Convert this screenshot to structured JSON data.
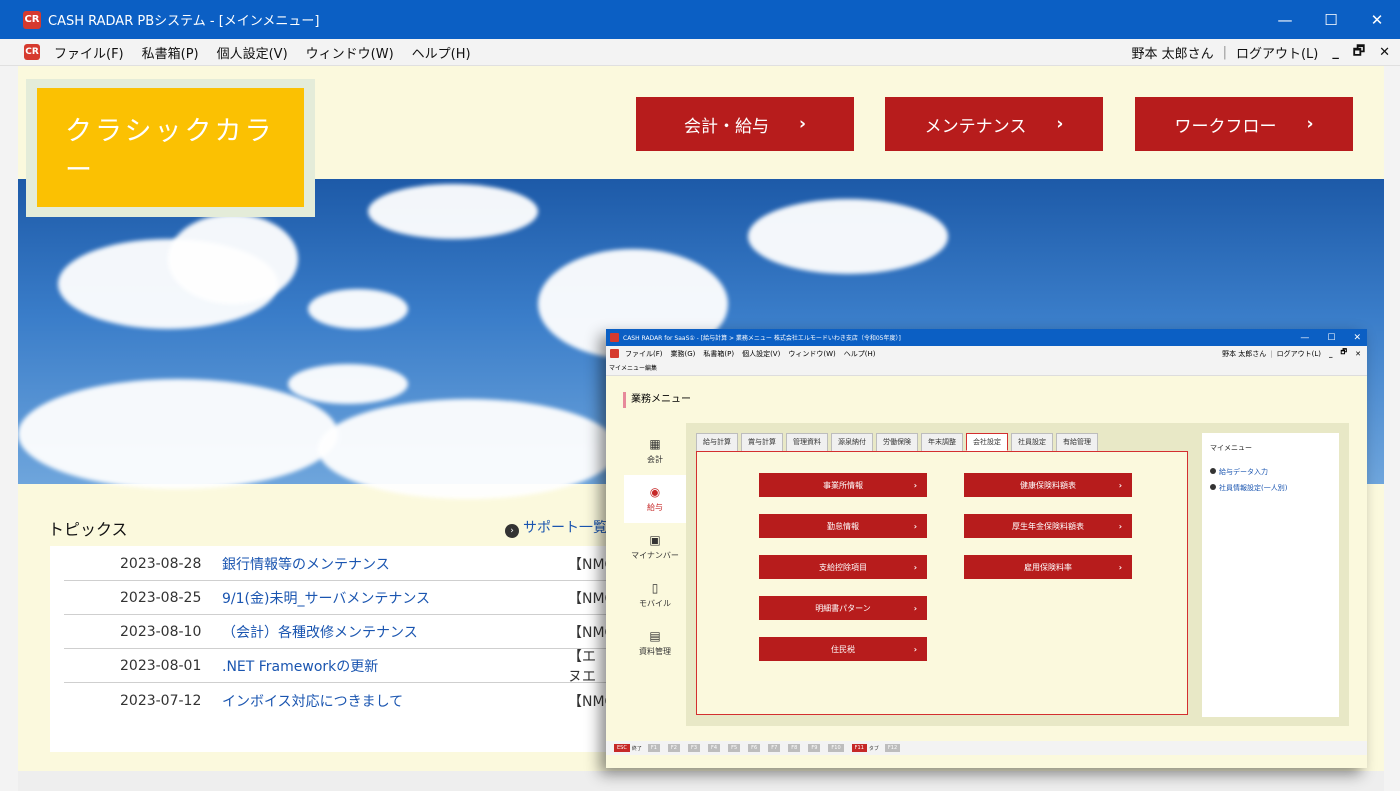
{
  "window": {
    "title": "CASH RADAR PBシステム - [メインメニュー]",
    "logo_text": "CR",
    "minimize": "—",
    "maximize": "☐",
    "close": "✕"
  },
  "menubar": {
    "items": [
      "ファイル(F)",
      "私書箱(P)",
      "個人設定(V)",
      "ウィンドウ(W)",
      "ヘルプ(H)"
    ],
    "user": "野本 太郎さん",
    "separator": "|",
    "logout": "ログアウト(L)",
    "controls": [
      "_",
      "🗗",
      "✕"
    ]
  },
  "badge": {
    "label": "クラシックカラー",
    "color": "#fbc102"
  },
  "nav_buttons": [
    {
      "label": "会計・給与",
      "arrow": "›"
    },
    {
      "label": "メンテナンス",
      "arrow": "›"
    },
    {
      "label": "ワークフロー",
      "arrow": "›"
    }
  ],
  "topics": {
    "heading": "トピックス",
    "support_link": "サポート一覧",
    "support_icon": "›",
    "items": [
      {
        "date": "2023-08-28",
        "title": "銀行情報等のメンテナンス",
        "source": "【NMC"
      },
      {
        "date": "2023-08-25",
        "title": "9/1(金)未明_サーバメンテナンス",
        "source": "【NMC"
      },
      {
        "date": "2023-08-10",
        "title": "（会計）各種改修メンテナンス",
        "source": "【NMC"
      },
      {
        "date": "2023-08-01",
        "title": ".NET Frameworkの更新",
        "source": "【エヌエ"
      },
      {
        "date": "2023-07-12",
        "title": "インボイス対応につきまして",
        "source": "【NMC"
      }
    ]
  },
  "inset": {
    "title": "CASH RADAR for SaaS① - [給与計算 > 業務メニュー 株式会社エルモードいわき支店（令和05年度）]",
    "menu": [
      "ファイル(F)",
      "業務(G)",
      "私書箱(P)",
      "個人設定(V)",
      "ウィンドウ(W)",
      "ヘルプ(H)"
    ],
    "user": "野本 太郎さん",
    "logout": "ログアウト(L)",
    "edit_label": "マイメニュー編集",
    "heading": "業務メニュー",
    "side": [
      {
        "icon": "▦",
        "label": "会計"
      },
      {
        "icon": "◉",
        "label": "給与"
      },
      {
        "icon": "▣",
        "label": "マイナンバー"
      },
      {
        "icon": "▯",
        "label": "モバイル"
      },
      {
        "icon": "▤",
        "label": "資料管理"
      }
    ],
    "tabs": [
      "給与計算",
      "賞与計算",
      "管理資料",
      "源泉納付",
      "労働保険",
      "年末調整",
      "会社設定",
      "社員設定",
      "有給管理"
    ],
    "left_buttons": [
      "事業所情報",
      "勤怠情報",
      "支給控除項目",
      "明細書パターン",
      "住民税"
    ],
    "right_buttons": [
      "健康保険料額表",
      "厚生年金保険料額表",
      "雇用保険料率"
    ],
    "button_arrow": "›",
    "mymenu_title": "マイメニュー",
    "mymenu_links": [
      "給与データ入力",
      "社員情報設定(一人別)"
    ],
    "fkeys": [
      {
        "key": "ESC",
        "label": "終了",
        "active": true
      },
      {
        "key": "F1",
        "label": ""
      },
      {
        "key": "F2",
        "label": ""
      },
      {
        "key": "F3",
        "label": ""
      },
      {
        "key": "F4",
        "label": ""
      },
      {
        "key": "F5",
        "label": ""
      },
      {
        "key": "F6",
        "label": ""
      },
      {
        "key": "F7",
        "label": ""
      },
      {
        "key": "F8",
        "label": ""
      },
      {
        "key": "F9",
        "label": ""
      },
      {
        "key": "F10",
        "label": ""
      },
      {
        "key": "F11",
        "label": "タブ",
        "active": true
      },
      {
        "key": "F12",
        "label": ""
      }
    ]
  },
  "colors": {
    "titlebar": "#0b5fc4",
    "accent_red": "#b71c1c",
    "background": "#fbf9dd"
  }
}
